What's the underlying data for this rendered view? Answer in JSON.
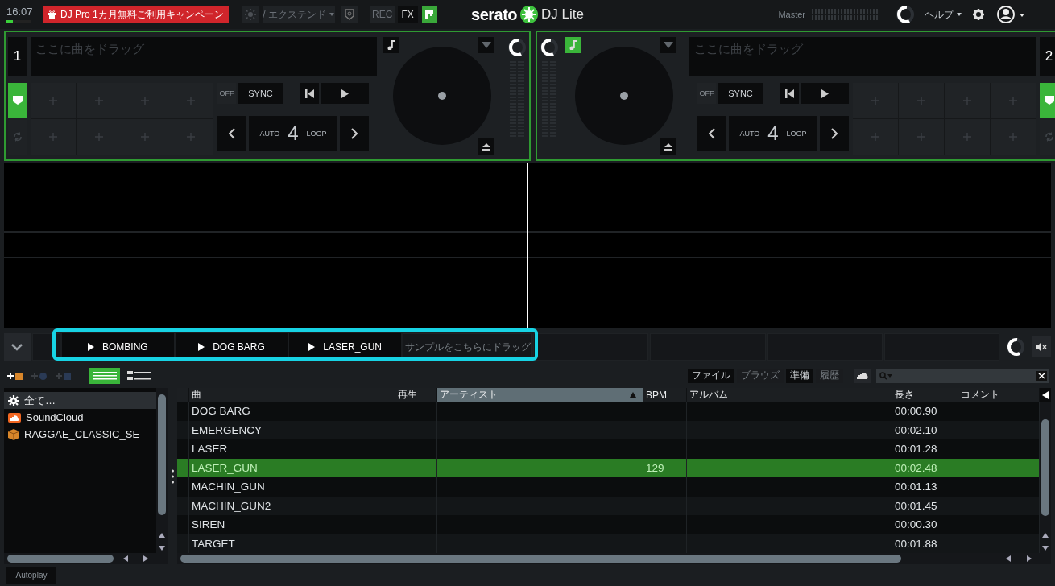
{
  "top_bar": {
    "clock": "16:07",
    "promo": "DJ Pro 1カ月無料ご利用キャンペーン",
    "expansion_menu": {
      "label": "/ エクステンド",
      "disabled": true
    },
    "rec_button": {
      "label": "REC",
      "disabled": true
    },
    "fx_button": {
      "label": "FX",
      "disabled": false
    },
    "logo": "serato",
    "product": "DJ Lite",
    "master_label": "Master",
    "help_menu": "ヘルプ"
  },
  "decks": [
    {
      "number": "1",
      "drop_hint": "ここに曲をドラッグ",
      "note_button": {
        "on": false
      },
      "pad_modes": [
        {
          "kind": "cue",
          "selected": true
        },
        {
          "kind": "roll",
          "selected": false
        }
      ],
      "sync_off": "OFF",
      "sync": "SYNC",
      "loop_mode": "AUTO",
      "loop_size": "4",
      "loop_label": "LOOP"
    },
    {
      "number": "2",
      "drop_hint": "ここに曲をドラッグ",
      "note_button": {
        "on": true
      },
      "pad_modes": [
        {
          "kind": "cue",
          "selected": true
        },
        {
          "kind": "roll",
          "selected": false
        }
      ],
      "sync_off": "OFF",
      "sync": "SYNC",
      "loop_mode": "AUTO",
      "loop_size": "4",
      "loop_label": "LOOP"
    }
  ],
  "sample_slots": [
    {
      "kind": "blank"
    },
    {
      "kind": "loaded",
      "label": "BOMBING"
    },
    {
      "kind": "loaded",
      "label": "DOG BARG"
    },
    {
      "kind": "loaded",
      "label": "LASER_GUN"
    },
    {
      "kind": "empty",
      "hint": "サンプルをこちらにドラッグ"
    },
    {
      "kind": "blank"
    },
    {
      "kind": "blank"
    },
    {
      "kind": "blank"
    },
    {
      "kind": "blank"
    }
  ],
  "crate_buttons": [
    {
      "kind": "crate",
      "disabled": false
    },
    {
      "kind": "smart",
      "disabled": true
    },
    {
      "kind": "subcrate",
      "disabled": true
    }
  ],
  "view_modes": [
    {
      "kind": "simple",
      "selected": true
    },
    {
      "kind": "detailed",
      "selected": false
    }
  ],
  "browser_tabs": [
    {
      "label": "ファイル",
      "disabled": false
    },
    {
      "label": "ブラウズ",
      "disabled": true
    },
    {
      "label": "準備",
      "disabled": false
    },
    {
      "label": "履歴",
      "disabled": true
    }
  ],
  "crates": [
    {
      "label": "全て…",
      "kind": "all",
      "selected": true
    },
    {
      "label": "SoundCloud",
      "kind": "soundcloud",
      "selected": false
    },
    {
      "label": "RAGGAE_CLASSIC_SE",
      "kind": "crate",
      "selected": false
    }
  ],
  "table": {
    "columns": [
      {
        "label": "曲",
        "sorted": false
      },
      {
        "label": "再生",
        "sorted": false
      },
      {
        "label": "アーティスト",
        "sorted": true
      },
      {
        "label": "BPM",
        "sorted": false
      },
      {
        "label": "アルバム",
        "sorted": false
      },
      {
        "label": "長さ",
        "sorted": false
      },
      {
        "label": "コメント",
        "sorted": false
      }
    ],
    "rows": [
      {
        "song": "DOG BARG",
        "length": "00:00.90",
        "selected": false
      },
      {
        "song": "EMERGENCY",
        "length": "00:02.10",
        "selected": false
      },
      {
        "song": "LASER",
        "length": "00:01.28",
        "selected": false
      },
      {
        "song": "LASER_GUN",
        "bpm": "129",
        "length": "00:02.48",
        "selected": true
      },
      {
        "song": "MACHIN_GUN",
        "length": "00:01.13",
        "selected": false
      },
      {
        "song": "MACHIN_GUN2",
        "length": "00:01.45",
        "selected": false
      },
      {
        "song": "SIREN",
        "length": "00:00.30",
        "selected": false
      },
      {
        "song": "TARGET",
        "length": "00:01.88",
        "selected": false
      }
    ]
  },
  "autoplay": "Autoplay"
}
